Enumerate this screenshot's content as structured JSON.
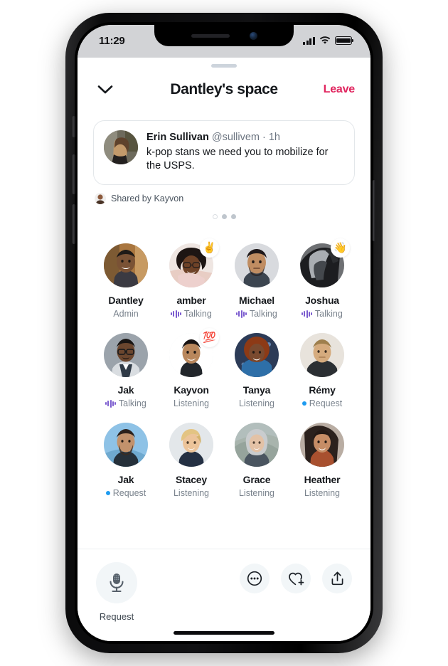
{
  "status_bar": {
    "time": "11:29",
    "signal_icon": "cellular-bars-icon",
    "wifi_icon": "wifi-icon",
    "battery_icon": "battery-full-icon"
  },
  "header": {
    "collapse_icon": "chevron-down-icon",
    "title": "Dantley's space",
    "leave_label": "Leave",
    "leave_color": "#e0245e"
  },
  "tweet_card": {
    "author": "Erin Sullivan",
    "handle": "@sullivem",
    "separator": " · ",
    "time": "1h",
    "text": "k-pop stans we need you to mobilize for the USPS.",
    "avatar_name": "tweet-author-avatar"
  },
  "shared_by": {
    "label": "Shared by Kayvon",
    "avatar_name": "shared-by-avatar"
  },
  "page_dots": [
    {
      "state": "inactive"
    },
    {
      "state": "active"
    },
    {
      "state": "active"
    }
  ],
  "participants": [
    {
      "name": "Dantley",
      "status": "Admin",
      "indicator": "none",
      "badge": "",
      "avatar_tone": "#6b4a36",
      "bg": "#a9763f"
    },
    {
      "name": "amber",
      "status": "Talking",
      "indicator": "talking",
      "badge": "✌️",
      "avatar_tone": "#3a2720",
      "bg": "#efe6e2"
    },
    {
      "name": "Michael",
      "status": "Talking",
      "indicator": "talking",
      "badge": "",
      "avatar_tone": "#5a3a28",
      "bg": "#d8dade"
    },
    {
      "name": "Joshua",
      "status": "Talking",
      "indicator": "talking",
      "badge": "👋",
      "avatar_tone": "#4a4a4c",
      "bg": "#6e7073"
    },
    {
      "name": "Jak",
      "status": "Talking",
      "indicator": "talking",
      "badge": "",
      "avatar_tone": "#3f2d22",
      "bg": "#9ba3ab"
    },
    {
      "name": "Kayvon",
      "status": "Listening",
      "indicator": "none",
      "badge": "💯",
      "avatar_tone": "#4d342a",
      "bg": "#ffffff"
    },
    {
      "name": "Tanya",
      "status": "Listening",
      "indicator": "none",
      "badge": "",
      "avatar_tone": "#8a3f20",
      "bg": "#2c3b57"
    },
    {
      "name": "Rémy",
      "status": "Request",
      "indicator": "request",
      "badge": "",
      "avatar_tone": "#c4a274",
      "bg": "#e8e3dc"
    },
    {
      "name": "Jak",
      "status": "Request",
      "indicator": "request",
      "badge": "",
      "avatar_tone": "#4a3a30",
      "bg": "#8ec2e6"
    },
    {
      "name": "Stacey",
      "status": "Listening",
      "indicator": "none",
      "badge": "",
      "avatar_tone": "#c9a66b",
      "bg": "#e3e7ea"
    },
    {
      "name": "Grace",
      "status": "Listening",
      "indicator": "none",
      "badge": "",
      "avatar_tone": "#b9bdc0",
      "bg": "#a8b4ad"
    },
    {
      "name": "Heather",
      "status": "Listening",
      "indicator": "none",
      "badge": "",
      "avatar_tone": "#3a2a22",
      "bg": "#b9ada3"
    }
  ],
  "toolbar": {
    "mic_icon": "microphone-icon",
    "mic_label": "Request",
    "actions": [
      {
        "icon": "more-circle-icon"
      },
      {
        "icon": "heart-plus-icon"
      },
      {
        "icon": "share-icon"
      }
    ]
  },
  "colors": {
    "talking_indicator": "#7b5ccf",
    "request_indicator": "#1d9bf0",
    "leave": "#e0245e"
  }
}
